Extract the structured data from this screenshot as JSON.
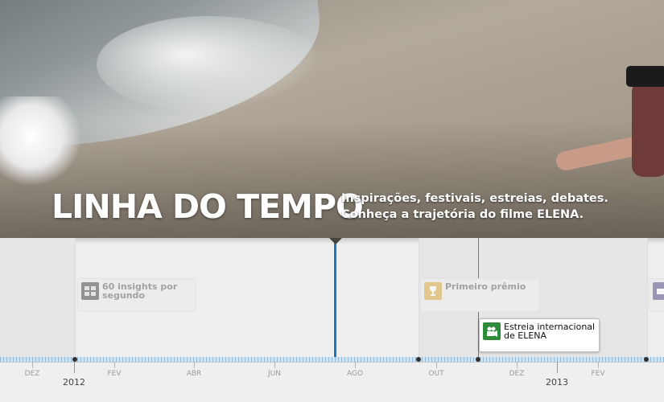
{
  "hero": {
    "title": "LINHA DO TEMPO",
    "subtitle_line1": "Inspirações, festivais, estreias, debates.",
    "subtitle_line2": "Conheça a trajetória do filme ELENA."
  },
  "events": [
    {
      "label": "60 insights por segundo",
      "icon": "film-frames-icon",
      "state": "inactive"
    },
    {
      "label": "Primeiro prêmio",
      "icon": "trophy-icon",
      "state": "inactive"
    },
    {
      "label": "Estreia internacional de ELENA",
      "icon": "video-camera-icon",
      "state": "active",
      "icon_color": "#2e8b3a"
    },
    {
      "label": "",
      "icon": "video-camera-icon",
      "state": "inactive"
    }
  ],
  "ruler": {
    "months": [
      "DEZ",
      "FEV",
      "ABR",
      "JUN",
      "AGO",
      "OUT",
      "DEZ",
      "FEV"
    ],
    "years": [
      "2012",
      "2013"
    ]
  },
  "colors": {
    "now_line": "#1e78c2",
    "ruler_fill": "#cfe3f2",
    "active_event_icon": "#2e8b3a"
  }
}
